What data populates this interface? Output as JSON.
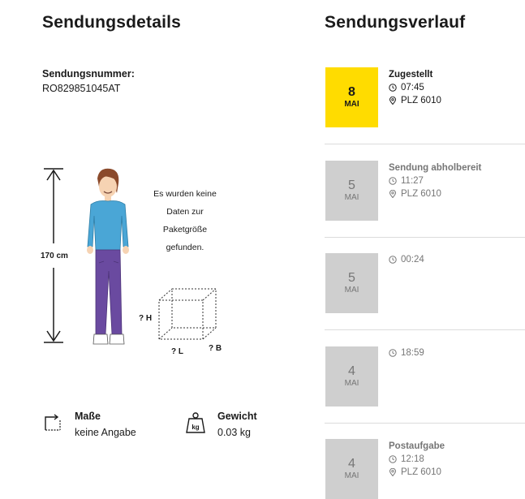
{
  "details": {
    "heading": "Sendungsdetails",
    "number_label": "Sendungsnummer:",
    "number_value": "RO829851045AT",
    "height_label": "170 cm",
    "no_data_lines": [
      "Es wurden keine",
      "Daten zur",
      "Paketgröße",
      "gefunden."
    ],
    "dim_h": "? H",
    "dim_l": "? L",
    "dim_b": "? B",
    "size_title": "Maße",
    "size_value": "keine Angabe",
    "weight_title": "Gewicht",
    "weight_value": "0.03 kg",
    "weight_icon_text": "kg"
  },
  "history": {
    "heading": "Sendungsverlauf",
    "events": [
      {
        "day": "8",
        "month": "MAI",
        "status": "Zugestellt",
        "time": "07:45",
        "location": "PLZ 6010",
        "active": true
      },
      {
        "day": "5",
        "month": "MAI",
        "status": "Sendung abholbereit",
        "time": "11:27",
        "location": "PLZ 6010",
        "active": false
      },
      {
        "day": "5",
        "month": "MAI",
        "status": "",
        "time": "00:24",
        "location": "",
        "active": false
      },
      {
        "day": "4",
        "month": "MAI",
        "status": "",
        "time": "18:59",
        "location": "",
        "active": false
      },
      {
        "day": "4",
        "month": "MAI",
        "status": "Postaufgabe",
        "time": "12:18",
        "location": "PLZ 6010",
        "active": false
      }
    ]
  },
  "colors": {
    "accent": "#ffdc00",
    "inactive_box": "#cfcfcf",
    "muted_text": "#767676"
  },
  "icons": {
    "time": "clock-icon",
    "location": "location-pin-icon",
    "size": "dimensions-icon",
    "weight": "weight-icon"
  }
}
